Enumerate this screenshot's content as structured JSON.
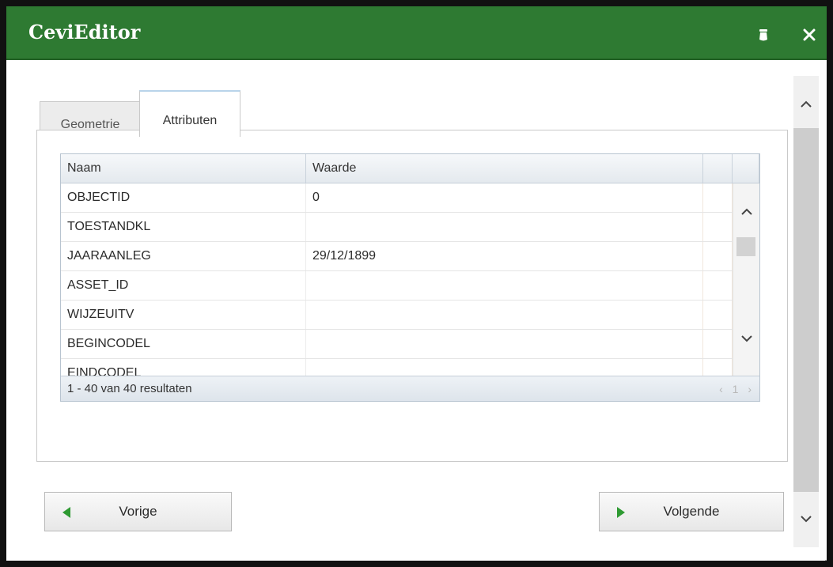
{
  "window": {
    "title": "CeviEditor",
    "accent_color": "#2e7a32",
    "icons": [
      "pin-icon",
      "close-icon"
    ]
  },
  "tabs": [
    {
      "label": "Geometrie",
      "active": false
    },
    {
      "label": "Attributen",
      "active": true
    }
  ],
  "grid": {
    "columns": [
      "Naam",
      "Waarde"
    ],
    "rows": [
      {
        "name": "OBJECTID",
        "value": "0"
      },
      {
        "name": "TOESTANDKL",
        "value": ""
      },
      {
        "name": "JAARAANLEG",
        "value": "29/12/1899"
      },
      {
        "name": "ASSET_ID",
        "value": ""
      },
      {
        "name": "WIJZEUITV",
        "value": ""
      },
      {
        "name": "BEGINCODEL",
        "value": ""
      },
      {
        "name": "EINDCODEL",
        "value": ""
      }
    ],
    "footer": "1 - 40 van 40 resultaten",
    "pager": {
      "prev": "‹",
      "page": "1",
      "next": "›"
    }
  },
  "buttons": {
    "prev_label": "Vorige",
    "next_label": "Volgende"
  }
}
